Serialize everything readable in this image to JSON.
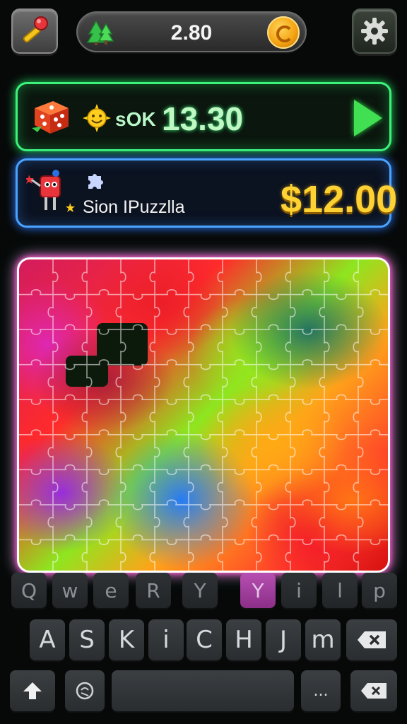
{
  "top_bar": {
    "currency_value": "2.80"
  },
  "banner_green": {
    "prefix": "ѕOK",
    "value": "13.30",
    "value_color": "#bff8c2"
  },
  "banner_blue": {
    "title": "Sion IPuzzlla",
    "price": "$12.00"
  },
  "board": {
    "border_color": "#ffffff",
    "glow_color": "#ff3fbf"
  },
  "keyboard": {
    "row1": [
      "Q",
      "w",
      "e",
      "R",
      "Y",
      "Y",
      "i",
      "l",
      "p"
    ],
    "row2": [
      "A",
      "S",
      "K",
      "i",
      "C",
      "H",
      "J",
      "m"
    ],
    "row3": {
      "dots": "..."
    }
  },
  "colors": {
    "green_neon": "#3cf27a",
    "blue_neon": "#4aa3ff",
    "gold": "#ffd233"
  }
}
